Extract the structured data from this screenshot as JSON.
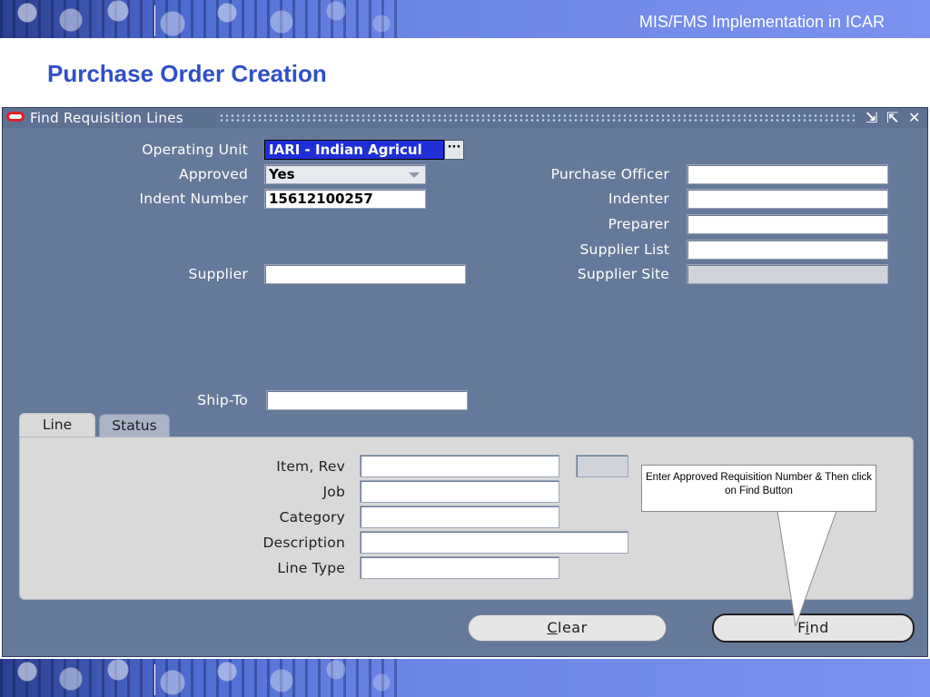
{
  "slide": {
    "header": "MIS/FMS Implementation in ICAR",
    "title": "Purchase Order Creation"
  },
  "window": {
    "title": "Find Requisition Lines",
    "buttons": {
      "minimize": "⇲",
      "maximize": "⇱",
      "close": "✕"
    }
  },
  "form": {
    "operating_unit": {
      "label": "Operating Unit",
      "value": "IARI - Indian Agricul",
      "lov": "···"
    },
    "approved": {
      "label": "Approved",
      "value": "Yes"
    },
    "indent_number": {
      "label": "Indent Number",
      "value": "15612100257"
    },
    "supplier": {
      "label": "Supplier",
      "value": ""
    },
    "ship_to": {
      "label": "Ship-To",
      "value": ""
    },
    "purchase_officer": {
      "label": "Purchase Officer",
      "value": ""
    },
    "indenter": {
      "label": "Indenter",
      "value": ""
    },
    "preparer": {
      "label": "Preparer",
      "value": ""
    },
    "supplier_list": {
      "label": "Supplier List",
      "value": ""
    },
    "supplier_site": {
      "label": "Supplier Site",
      "value": ""
    }
  },
  "tabs": [
    {
      "label": "Line",
      "active": true
    },
    {
      "label": "Status",
      "active": false
    }
  ],
  "line_tab": {
    "item_rev": {
      "label": "Item, Rev",
      "value": "",
      "rev_value": ""
    },
    "job": {
      "label": "Job",
      "value": ""
    },
    "category": {
      "label": "Category",
      "value": ""
    },
    "description": {
      "label": "Description",
      "value": ""
    },
    "line_type": {
      "label": "Line Type",
      "value": ""
    }
  },
  "actions": {
    "clear": {
      "mnemonic": "C",
      "rest": "lear"
    },
    "find": {
      "pre": "F",
      "mnemonic": "i",
      "rest": "nd"
    }
  },
  "callout": {
    "text": "Enter Approved Requisition Number & Then click on Find Button"
  },
  "colors": {
    "banner": "#4e6cd0",
    "title": "#3050c8",
    "form_background": "#657a9a",
    "selected_field": "#1f2fd8",
    "tab_panel": "#d9d9d9"
  }
}
